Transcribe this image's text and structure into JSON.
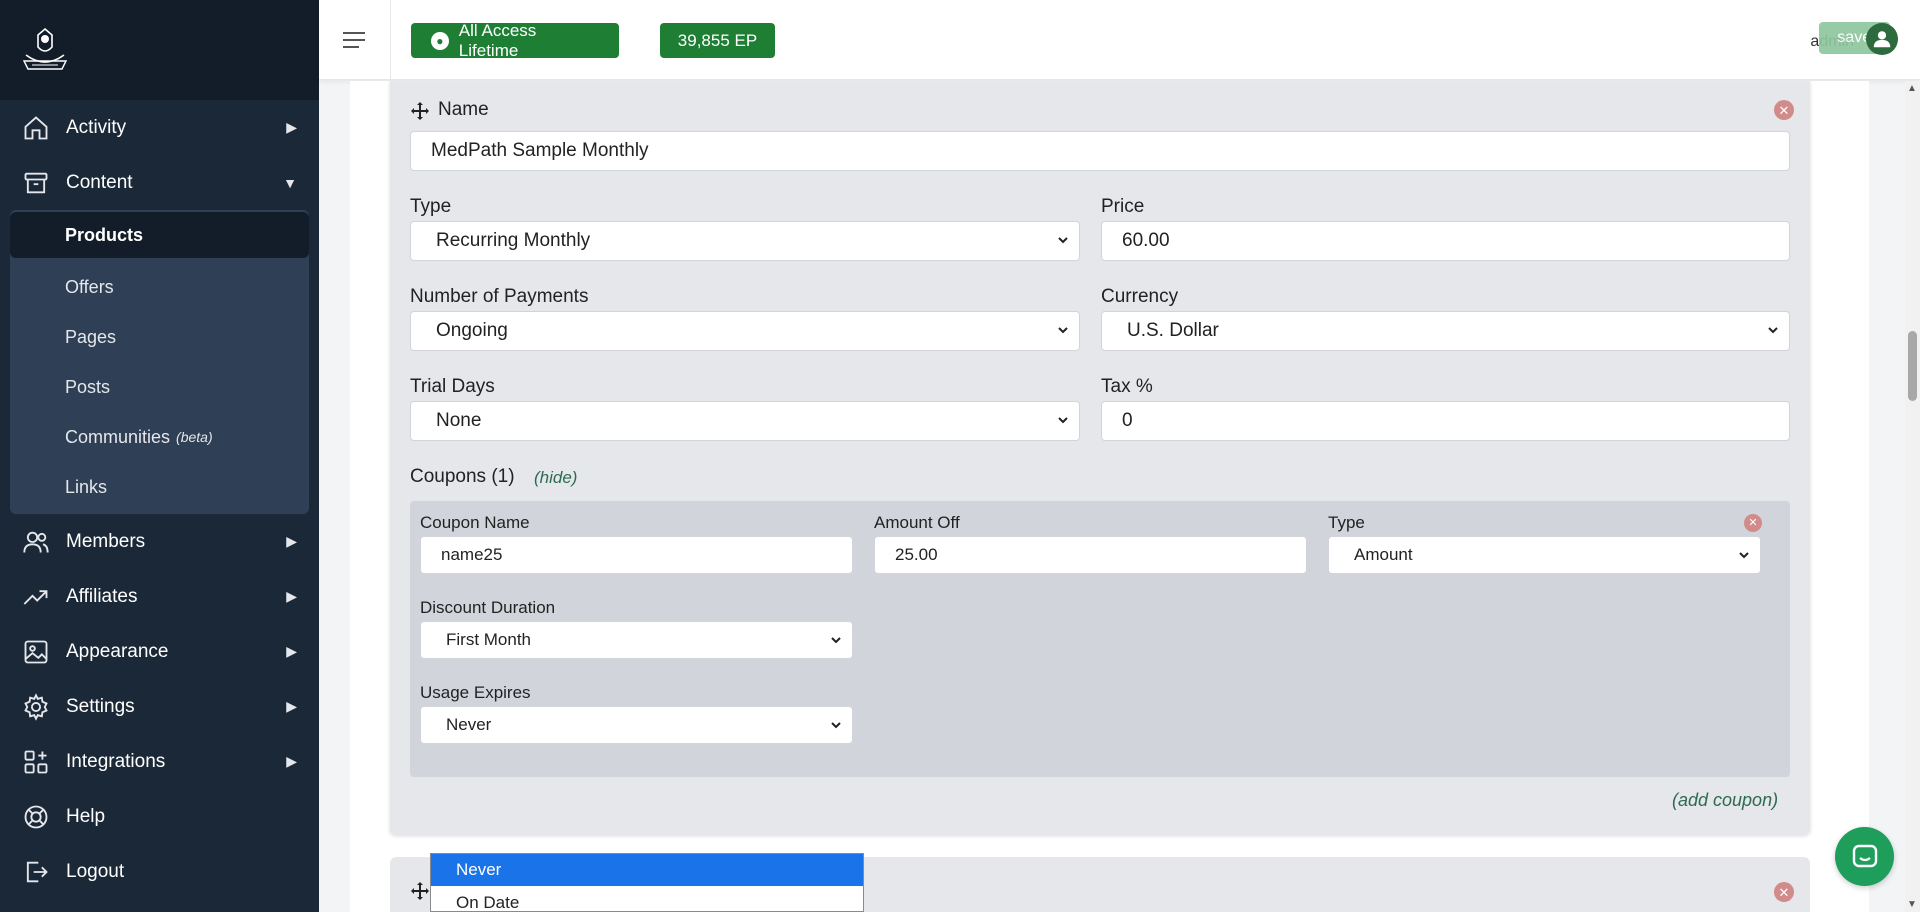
{
  "header": {
    "plan_badge": "All Access Lifetime",
    "points_badge": "39,855 EP",
    "admin_name": "admin",
    "saved_label": "saved"
  },
  "sidebar": {
    "items": [
      {
        "label": "Activity",
        "icon": "home-icon"
      },
      {
        "label": "Content",
        "icon": "archive-box-icon"
      },
      {
        "label": "Members",
        "icon": "users-icon"
      },
      {
        "label": "Affiliates",
        "icon": "trending-up-icon"
      },
      {
        "label": "Appearance",
        "icon": "image-icon"
      },
      {
        "label": "Settings",
        "icon": "gear-icon"
      },
      {
        "label": "Integrations",
        "icon": "apps-grid-icon"
      },
      {
        "label": "Help",
        "icon": "lifebuoy-icon"
      },
      {
        "label": "Logout",
        "icon": "logout-icon"
      }
    ],
    "content_submenu": [
      {
        "label": "Products",
        "active": true
      },
      {
        "label": "Offers"
      },
      {
        "label": "Pages"
      },
      {
        "label": "Posts"
      },
      {
        "label": "Communities",
        "badge": "(beta)"
      },
      {
        "label": "Links"
      }
    ]
  },
  "product": {
    "name_label": "Name",
    "name_value": "MedPath Sample Monthly",
    "type_label": "Type",
    "type_value": "Recurring Monthly",
    "price_label": "Price",
    "price_value": "60.00",
    "payments_label": "Number of Payments",
    "payments_value": "Ongoing",
    "currency_label": "Currency",
    "currency_value": "U.S. Dollar",
    "trial_label": "Trial Days",
    "trial_value": "None",
    "tax_label": "Tax %",
    "tax_value": "0",
    "coupons_label": "Coupons (1)",
    "hide_link": "(hide)",
    "add_coupon_link": "(add coupon)"
  },
  "coupon": {
    "name_label": "Coupon Name",
    "name_value": "name25",
    "amount_label": "Amount Off",
    "amount_value": "25.00",
    "type_label": "Type",
    "type_value": "Amount",
    "duration_label": "Discount Duration",
    "duration_value": "First Month",
    "expires_label": "Usage Expires",
    "expires_value": "Never"
  },
  "dropdown": {
    "options": [
      "Never",
      "On Date"
    ],
    "selected": "Never"
  },
  "colors": {
    "sidebar_bg": "#1b2838",
    "accent_green": "#1e7e34",
    "selected_option": "#1a73e8"
  }
}
